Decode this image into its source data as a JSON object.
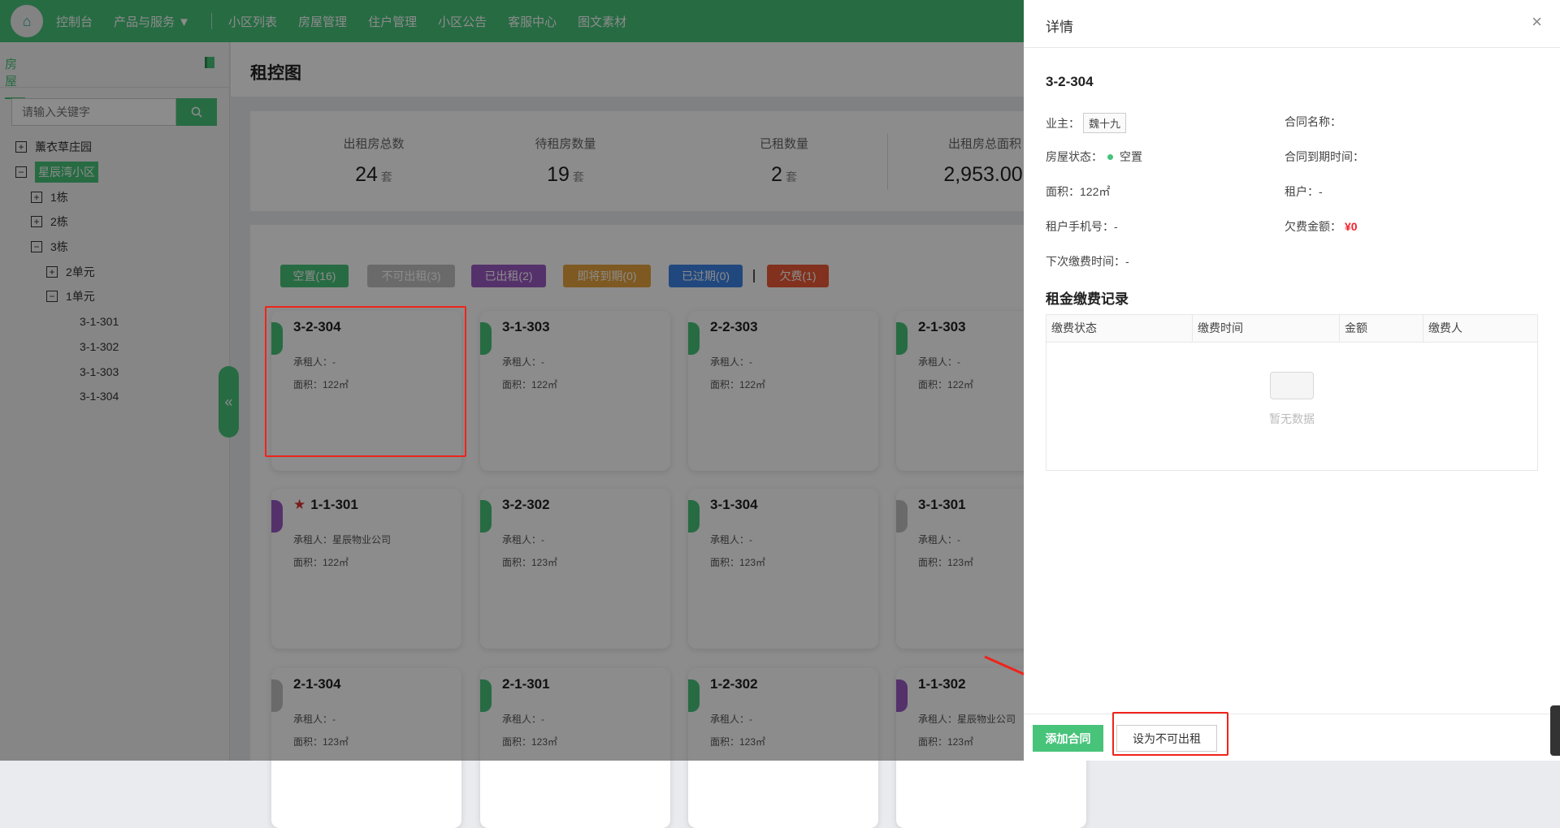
{
  "nav": {
    "items": [
      "控制台",
      "产品与服务 ▼",
      "小区列表",
      "房屋管理",
      "住户管理",
      "小区公告",
      "客服中心",
      "图文素材"
    ]
  },
  "sidebar": {
    "tab": "房屋",
    "search_placeholder": "请输入关键字",
    "tree": [
      {
        "label": "薰衣草庄园",
        "toggle": "+",
        "level": 0
      },
      {
        "label": "星辰湾小区",
        "toggle": "−",
        "level": 0,
        "selected": true
      },
      {
        "label": "1栋",
        "toggle": "+",
        "level": 1
      },
      {
        "label": "2栋",
        "toggle": "+",
        "level": 1
      },
      {
        "label": "3栋",
        "toggle": "−",
        "level": 1
      },
      {
        "label": "2单元",
        "toggle": "+",
        "level": 2
      },
      {
        "label": "1单元",
        "toggle": "−",
        "level": 2
      },
      {
        "label": "3-1-301",
        "level": 3
      },
      {
        "label": "3-1-302",
        "level": 3
      },
      {
        "label": "3-1-303",
        "level": 3
      },
      {
        "label": "3-1-304",
        "level": 3
      }
    ],
    "collapse_glyph": "«"
  },
  "main": {
    "title": "租控图",
    "stats": [
      {
        "label": "出租房总数",
        "value": "24",
        "unit": "套"
      },
      {
        "label": "待租房数量",
        "value": "19",
        "unit": "套"
      },
      {
        "label": "已租数量",
        "value": "2",
        "unit": "套"
      },
      {
        "label": "出租房总面积",
        "value": "2,953.00",
        "unit": ""
      }
    ],
    "filters": [
      {
        "label": "空置(16)",
        "color": "#47c37a"
      },
      {
        "label": "不可出租(3)",
        "color": "#c2c2c2"
      },
      {
        "label": "已出租(2)",
        "color": "#9b59c4"
      },
      {
        "label": "即将到期(0)",
        "color": "#e6a23c"
      },
      {
        "label": "已过期(0)",
        "color": "#3c83e6"
      },
      {
        "label": "欠费(1)",
        "color": "#ec5a36"
      }
    ],
    "cards": [
      {
        "num": "3-2-304",
        "tenant": "承租人：-",
        "area": "面积：122㎡",
        "color": "#47c37a"
      },
      {
        "num": "3-1-303",
        "tenant": "承租人：-",
        "area": "面积：122㎡",
        "color": "#47c37a"
      },
      {
        "num": "2-2-303",
        "tenant": "承租人：-",
        "area": "面积：122㎡",
        "color": "#47c37a"
      },
      {
        "num": "2-1-303",
        "tenant": "承租人：-",
        "area": "面积：122㎡",
        "color": "#47c37a"
      },
      {
        "num": "1-1-301",
        "tenant": "承租人：星辰物业公司",
        "area": "面积：122㎡",
        "color": "#9b59c4",
        "star": true
      },
      {
        "num": "3-2-302",
        "tenant": "承租人：-",
        "area": "面积：123㎡",
        "color": "#47c37a"
      },
      {
        "num": "3-1-304",
        "tenant": "承租人：-",
        "area": "面积：123㎡",
        "color": "#47c37a"
      },
      {
        "num": "3-1-301",
        "tenant": "承租人：-",
        "area": "面积：123㎡",
        "color": "#c2c2c2"
      },
      {
        "num": "2-1-304",
        "tenant": "承租人：-",
        "area": "面积：123㎡",
        "color": "#c2c2c2"
      },
      {
        "num": "2-1-301",
        "tenant": "承租人：-",
        "area": "面积：123㎡",
        "color": "#47c37a"
      },
      {
        "num": "1-2-302",
        "tenant": "承租人：-",
        "area": "面积：123㎡",
        "color": "#47c37a"
      },
      {
        "num": "1-1-302",
        "tenant": "承租人：星辰物业公司",
        "area": "面积：123㎡",
        "color": "#9b59c4"
      }
    ]
  },
  "drawer": {
    "title": "详情",
    "close": "×",
    "room": "3-2-304",
    "owner_label": "业主：",
    "owner": "魏十九",
    "status_label": "房屋状态：",
    "status": "空置",
    "area": "面积：122㎡",
    "tenant_phone": "租户手机号：-",
    "next_pay": "下次缴费时间：-",
    "contract_name": "合同名称：",
    "contract_expire": "合同到期时间：",
    "tenant": "租户：-",
    "arrears_label": "欠费金额：",
    "arrears": "¥0",
    "records_title": "租金缴费记录",
    "columns": [
      "缴费状态",
      "缴费时间",
      "金额",
      "缴费人"
    ],
    "empty": "暂无数据",
    "add_contract": "添加合同",
    "set_unrentable": "设为不可出租"
  }
}
